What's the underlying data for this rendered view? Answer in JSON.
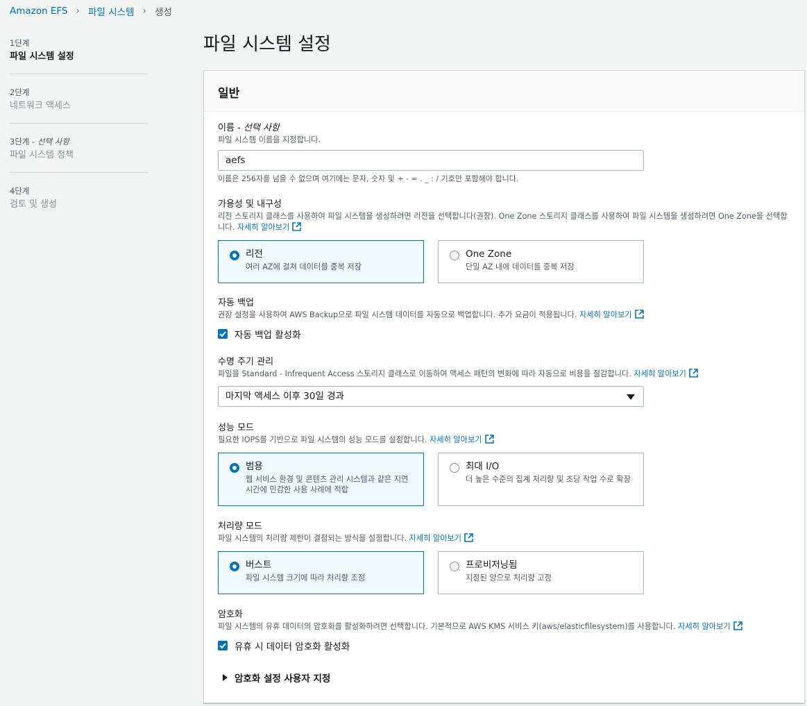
{
  "breadcrumb": {
    "items": [
      "Amazon EFS",
      "파일 시스템"
    ],
    "current": "생성"
  },
  "steps": [
    {
      "num": "1단계",
      "label": "파일 시스템 설정"
    },
    {
      "num": "2단계",
      "label": "네트워크 액세스"
    },
    {
      "num": "3단계",
      "num_optional": "선택 사항",
      "label": "파일 시스템 정책"
    },
    {
      "num": "4단계",
      "label": "검토 및 생성"
    }
  ],
  "page_title": "파일 시스템 설정",
  "panel": {
    "title": "일반",
    "learn_more": "자세히 알아보기",
    "name": {
      "label": "이름 - ",
      "label_optional": "선택 사항",
      "desc": "파일 시스템 이름을 지정합니다.",
      "value": "aefs",
      "constraint": "이름은 256자를 넘을 수 없으며 여기에는 문자, 숫자 및 + - = . _ : / 기호만 포함해야 합니다."
    },
    "availability": {
      "label": "가용성 및 내구성",
      "desc": "리전 스토리지 클래스를 사용하여 파일 시스템을 생성하려면 리전을 선택합니다(권장). One Zone 스토리지 클래스를 사용하여 파일 시스템을 생성하려면 One Zone을 선택합니다.",
      "options": [
        {
          "title": "리전",
          "desc": "여러 AZ에 걸쳐 데이터를 중복 저장",
          "selected": true
        },
        {
          "title": "One Zone",
          "desc": "단일 AZ 내에 데이터를 중복 저장",
          "selected": false
        }
      ]
    },
    "backup": {
      "label": "자동 백업",
      "desc": "권장 설정을 사용하여 AWS Backup으로 파일 시스템 데이터를 자동으로 백업합니다. 추가 요금이 적용됩니다.",
      "checkbox": "자동 백업 활성화",
      "checked": true
    },
    "lifecycle": {
      "label": "수명 주기 관리",
      "desc": "파일을 Standard - Infrequent Access 스토리지 클래스로 이동하여 액세스 패턴의 변화에 따라 자동으로 비용을 절감합니다.",
      "selected": "마지막 액세스 이후 30일 경과"
    },
    "performance": {
      "label": "성능 모드",
      "desc": "필요한 IOPS를 기반으로 파일 시스템의 성능 모드를 설정합니다.",
      "options": [
        {
          "title": "범용",
          "desc": "웹 서비스 환경 및 콘텐츠 관리 시스템과 같은 지연 시간에 민감한 사용 사례에 적합",
          "selected": true
        },
        {
          "title": "최대 I/O",
          "desc": "더 높은 수준의 집계 처리량 및 초당 작업 수로 확장",
          "selected": false
        }
      ]
    },
    "throughput": {
      "label": "처리량 모드",
      "desc": "파일 시스템의 처리량 제한이 결정되는 방식을 설정합니다.",
      "options": [
        {
          "title": "버스트",
          "desc": "파일 시스템 크기에 따라 처리량 조정",
          "selected": true
        },
        {
          "title": "프로비저닝됨",
          "desc": "지정된 양으로 처리량 고정",
          "selected": false
        }
      ]
    },
    "encryption": {
      "label": "암호화",
      "desc": "파일 시스템의 유휴 데이터의 암호화를 활성화하려면 선택합니다. 기본적으로 AWS KMS 서비스 키(aws/elasticfilesystem)를 사용합니다.",
      "checkbox": "유휴 시 데이터 암호화 활성화",
      "checked": true,
      "expander": "암호화 설정 사용자 지정"
    }
  },
  "colors": {
    "accent": "#0073bb",
    "selected_bg": "#f1faff",
    "page_bg": "#f2f3f3"
  }
}
